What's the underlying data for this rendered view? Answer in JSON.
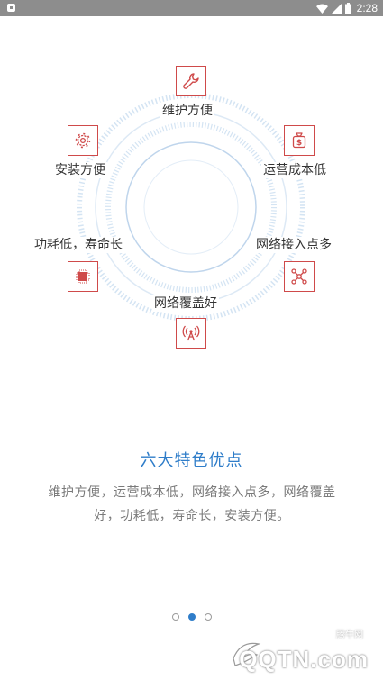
{
  "status_bar": {
    "time": "2:28",
    "icons": [
      "notification-icon",
      "wifi-icon",
      "signal-icon",
      "battery-icon"
    ]
  },
  "features": [
    {
      "label": "维护方便",
      "icon": "wrench-icon"
    },
    {
      "label": "运营成本低",
      "icon": "money-bag-icon"
    },
    {
      "label": "网络接入点多",
      "icon": "network-nodes-icon"
    },
    {
      "label": "网络覆盖好",
      "icon": "antenna-icon"
    },
    {
      "label": "功耗低，寿命长",
      "icon": "chip-icon"
    },
    {
      "label": "安装方便",
      "icon": "gear-icon"
    }
  ],
  "slide": {
    "title": "六大特色优点",
    "description": "维护方便，运营成本低，网络接入点多，网络覆盖好，功耗低，寿命长，安装方便。"
  },
  "pager": {
    "total": 3,
    "active_index": 1
  },
  "watermark": {
    "text": "QQTN.com",
    "small_text": "腾牛网"
  },
  "colors": {
    "accent": "#2f7dc9",
    "icon_red": "#cf4a4a",
    "ring": "#c8dcf0",
    "status_bar": "#8d8d8d"
  }
}
